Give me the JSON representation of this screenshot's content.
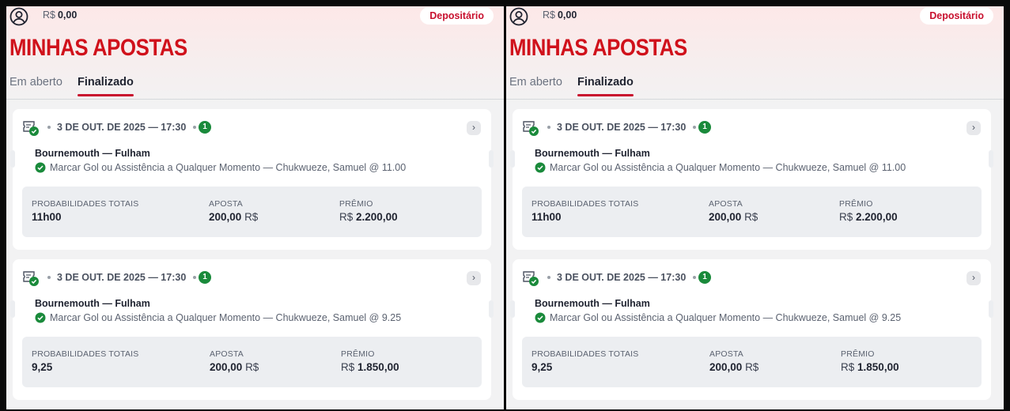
{
  "header": {
    "balance_currency": "R$",
    "balance_amount": "0,00",
    "deposit_label": "Depositário"
  },
  "page_title": "MINHAS APOSTAS",
  "tabs": [
    {
      "label": "Em aberto",
      "active": false
    },
    {
      "label": "Finalizado",
      "active": true
    }
  ],
  "summary_labels": {
    "odds": "PROBABILIDADES TOTAIS",
    "stake": "APOSTA",
    "prize": "PRÊMIO"
  },
  "bets": [
    {
      "date": "3 DE OUT. DE 2025 — 17:30",
      "count": "1",
      "match": "Bournemouth — Fulham",
      "selection": "Marcar Gol ou Assistência a Qualquer Momento — Chukwueze, Samuel @ 11.00",
      "odds": "11h00",
      "stake_value": "200,00",
      "stake_currency": "R$",
      "prize_currency": "R$",
      "prize_value": "2.200,00"
    },
    {
      "date": "3 DE OUT. DE 2025 — 17:30",
      "count": "1",
      "match": "Bournemouth — Fulham",
      "selection": "Marcar Gol ou Assistência a Qualquer Momento — Chukwueze, Samuel @ 9.25",
      "odds": "9,25",
      "stake_value": "200,00",
      "stake_currency": "R$",
      "prize_currency": "R$",
      "prize_value": "1.850,00"
    }
  ],
  "colors": {
    "brand_red": "#c8102e",
    "title_red": "#d0111b",
    "win_green": "#1a8a3b"
  },
  "icons": [
    "user-circle-icon",
    "ticket-check-icon",
    "chevron-right-icon",
    "check-circle-icon"
  ]
}
